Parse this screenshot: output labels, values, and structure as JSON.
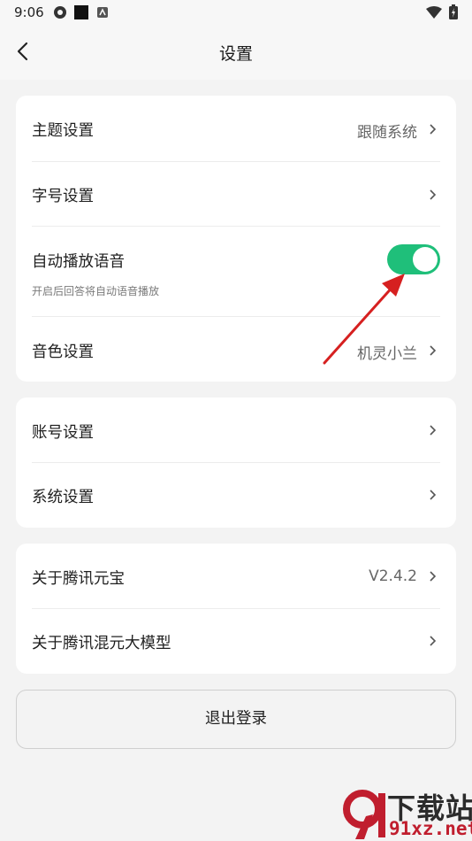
{
  "status_bar": {
    "time": "9:06"
  },
  "header": {
    "title": "设置"
  },
  "card1": {
    "theme": {
      "label": "主题设置",
      "value": "跟随系统"
    },
    "font_size": {
      "label": "字号设置"
    },
    "auto_voice": {
      "label": "自动播放语音",
      "sub": "开启后回答将自动语音播放",
      "enabled": true
    },
    "voice_tone": {
      "label": "音色设置",
      "value": "机灵小兰"
    }
  },
  "card2": {
    "account": {
      "label": "账号设置"
    },
    "system": {
      "label": "系统设置"
    }
  },
  "card3": {
    "about_yuanbao": {
      "label": "关于腾讯元宝",
      "value": "V2.4.2"
    },
    "about_hunyuan": {
      "label": "关于腾讯混元大模型"
    }
  },
  "logout": {
    "label": "退出登录"
  },
  "watermark": {
    "brand": "下载站",
    "domain": "91xz.net"
  },
  "colors": {
    "toggle_on": "#1fbf7a",
    "annotation_arrow": "#d62020",
    "background": "#f3f3f3"
  },
  "icons": [
    "back-arrow-icon",
    "chevron-right-icon",
    "wifi-icon",
    "battery-icon"
  ]
}
